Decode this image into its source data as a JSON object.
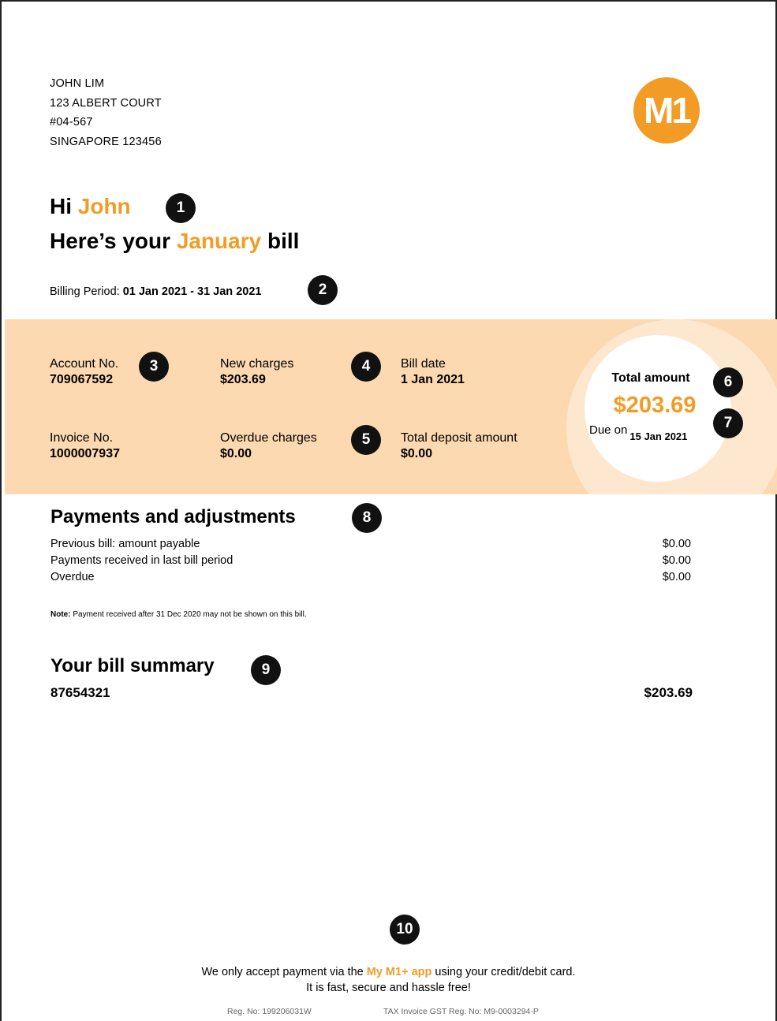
{
  "customer": {
    "name_line": "JOHN LIM",
    "address_line1": "123 ALBERT COURT",
    "address_line2": "#04-567",
    "address_line3": "SINGAPORE 123456"
  },
  "logo_text": "M1",
  "greeting": {
    "hi": "Hi",
    "first_name": "John",
    "heres_your": "Here’s your",
    "month": "January",
    "bill": "bill"
  },
  "billing_period": {
    "label": "Billing Period:",
    "value": "01 Jan 2021 - 31 Jan 2021"
  },
  "summary_band": {
    "account_no_label": "Account No.",
    "account_no": "709067592",
    "new_charges_label": "New charges",
    "new_charges": "$203.69",
    "bill_date_label": "Bill date",
    "bill_date": "1 Jan 2021",
    "invoice_no_label": "Invoice No.",
    "invoice_no": "1000007937",
    "overdue_charges_label": "Overdue charges",
    "overdue_charges": "$0.00",
    "total_deposit_label": "Total deposit amount",
    "total_deposit": "$0.00",
    "total_amount_label": "Total amount",
    "total_amount": "$203.69",
    "due_on_label": "Due on",
    "due_date": "15 Jan 2021"
  },
  "payments": {
    "title": "Payments and adjustments",
    "rows": [
      {
        "label": "Previous bill: amount payable",
        "amount": "$0.00"
      },
      {
        "label": "Payments received in last bill period",
        "amount": "$0.00"
      },
      {
        "label": "Overdue",
        "amount": "$0.00"
      }
    ],
    "note_label": "Note:",
    "note_text": "Payment received after 31 Dec 2020 may not be shown on this bill."
  },
  "bill_summary": {
    "title": "Your bill summary",
    "number": "87654321",
    "amount": "$203.69"
  },
  "callouts": [
    "1",
    "2",
    "3",
    "4",
    "5",
    "6",
    "7",
    "8",
    "9",
    "10"
  ],
  "footer": {
    "line1_before": "We only accept payment via the",
    "app_name": "My M1+ app",
    "line1_after": "using your credit/debit card.",
    "line2": "It is fast, secure and hassle free!",
    "reg_no": "Reg. No: 199206031W",
    "gst_reg": "TAX Invoice GST Reg. No: M9-0003294-P"
  },
  "colors": {
    "accent": "#f39c25",
    "band": "#fcd9b1",
    "badge": "#111111"
  }
}
